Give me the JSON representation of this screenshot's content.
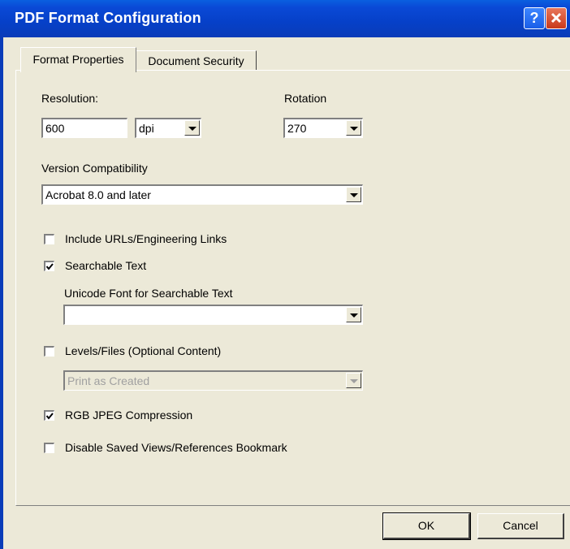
{
  "window": {
    "title": "PDF Format Configuration",
    "help_glyph": "?",
    "accent": "#0a49d6"
  },
  "tabs": [
    {
      "label": "Format Properties",
      "active": true
    },
    {
      "label": "Document Security",
      "active": false
    }
  ],
  "resolution": {
    "label": "Resolution:",
    "value": "600",
    "unit": "dpi"
  },
  "rotation": {
    "label": "Rotation",
    "value": "270"
  },
  "version": {
    "label": "Version Compatibility",
    "value": "Acrobat 8.0 and later"
  },
  "options": {
    "include_urls": {
      "label": "Include URLs/Engineering Links",
      "checked": false
    },
    "searchable_text": {
      "label": "Searchable Text",
      "checked": true
    },
    "unicode_font": {
      "label": "Unicode Font for Searchable Text",
      "value": ""
    },
    "levels_files": {
      "label": "Levels/Files (Optional Content)",
      "checked": false
    },
    "levels_mode": {
      "value": "Print as Created",
      "enabled": false
    },
    "rgb_jpeg": {
      "label": "RGB JPEG Compression",
      "checked": true
    },
    "disable_saved_views": {
      "label": "Disable Saved Views/References Bookmark",
      "checked": false
    }
  },
  "buttons": {
    "ok": "OK",
    "cancel": "Cancel"
  },
  "icons": {
    "help": "help-icon",
    "close": "close-icon",
    "check": "checkmark-icon",
    "dropdown": "chevron-down-icon"
  }
}
